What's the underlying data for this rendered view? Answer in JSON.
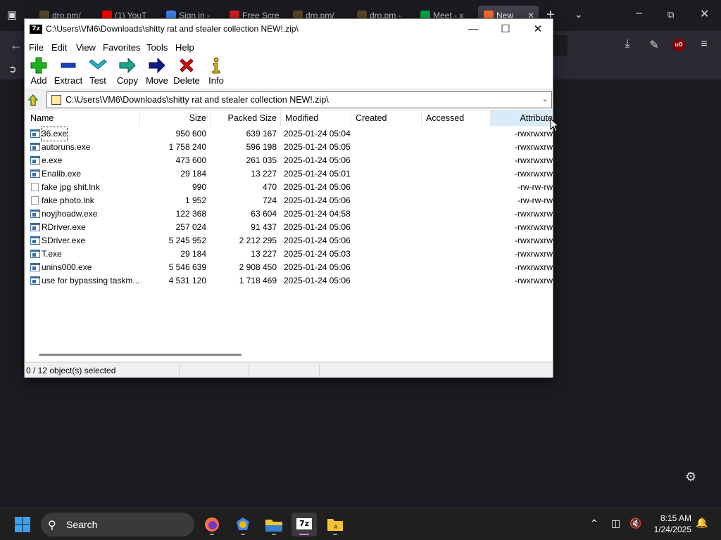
{
  "browser": {
    "tabs": [
      {
        "label": "dro.pm/",
        "color": "#5a4a2a"
      },
      {
        "label": "(1) YouT",
        "color": "#ff0000"
      },
      {
        "label": "Sign in -",
        "color": "#4285f4"
      },
      {
        "label": "Free Scre",
        "color": "#d92020"
      },
      {
        "label": "dro.pm/",
        "color": "#5a4a2a"
      },
      {
        "label": "dro.pm -",
        "color": "#5a4a2a"
      },
      {
        "label": "Meet - x",
        "color": "#00ac47"
      },
      {
        "label": "New",
        "color": "#ff7139"
      }
    ]
  },
  "window": {
    "title": "C:\\Users\\VM6\\Downloads\\shitty rat and stealer collection NEW!.zip\\",
    "app_icon": "7z"
  },
  "menu": [
    "File",
    "Edit",
    "View",
    "Favorites",
    "Tools",
    "Help"
  ],
  "toolbar": {
    "add": "Add",
    "extract": "Extract",
    "test": "Test",
    "copy": "Copy",
    "move": "Move",
    "delete": "Delete",
    "info": "Info"
  },
  "address": "C:\\Users\\VM6\\Downloads\\shitty rat and stealer collection NEW!.zip\\",
  "columns": {
    "name": "Name",
    "size": "Size",
    "packed": "Packed Size",
    "modified": "Modified",
    "created": "Created",
    "accessed": "Accessed",
    "attributes": "Attribute"
  },
  "files": [
    {
      "name": "36.exe",
      "size": "950 600",
      "packed": "639 167",
      "modified": "2025-01-24 05:04",
      "attr": "-rwxrwxrw",
      "type": "exe"
    },
    {
      "name": "autoruns.exe",
      "size": "1 758 240",
      "packed": "596 198",
      "modified": "2025-01-24 05:05",
      "attr": "-rwxrwxrw",
      "type": "exe"
    },
    {
      "name": "e.exe",
      "size": "473 600",
      "packed": "261 035",
      "modified": "2025-01-24 05:06",
      "attr": "-rwxrwxrw",
      "type": "exe"
    },
    {
      "name": "Enalib.exe",
      "size": "29 184",
      "packed": "13 227",
      "modified": "2025-01-24 05:01",
      "attr": "-rwxrwxrw",
      "type": "exe"
    },
    {
      "name": "fake jpg shit.lnk",
      "size": "990",
      "packed": "470",
      "modified": "2025-01-24 05:06",
      "attr": "-rw-rw-rw",
      "type": "lnk"
    },
    {
      "name": "fake photo.lnk",
      "size": "1 952",
      "packed": "724",
      "modified": "2025-01-24 05:06",
      "attr": "-rw-rw-rw",
      "type": "lnk"
    },
    {
      "name": "noyjhoadw.exe",
      "size": "122 368",
      "packed": "63 604",
      "modified": "2025-01-24 04:58",
      "attr": "-rwxrwxrw",
      "type": "exe"
    },
    {
      "name": "RDriver.exe",
      "size": "257 024",
      "packed": "91 437",
      "modified": "2025-01-24 05:06",
      "attr": "-rwxrwxrw",
      "type": "exe"
    },
    {
      "name": "SDriver.exe",
      "size": "5 245 952",
      "packed": "2 212 295",
      "modified": "2025-01-24 05:06",
      "attr": "-rwxrwxrw",
      "type": "exe"
    },
    {
      "name": "T.exe",
      "size": "29 184",
      "packed": "13 227",
      "modified": "2025-01-24 05:03",
      "attr": "-rwxrwxrw",
      "type": "exe"
    },
    {
      "name": "unins000.exe",
      "size": "5 546 639",
      "packed": "2 908 450",
      "modified": "2025-01-24 05:06",
      "attr": "-rwxrwxrw",
      "type": "exe"
    },
    {
      "name": "use for bypassing taskm...",
      "size": "4 531 120",
      "packed": "1 718 469",
      "modified": "2025-01-24 05:06",
      "attr": "-rwxrwxrw",
      "type": "exe"
    }
  ],
  "status": "0 / 12 object(s) selected",
  "taskbar": {
    "search_label": "Search",
    "time": "8:15 AM",
    "date": "1/24/2025",
    "app_7z_label": "7z"
  }
}
